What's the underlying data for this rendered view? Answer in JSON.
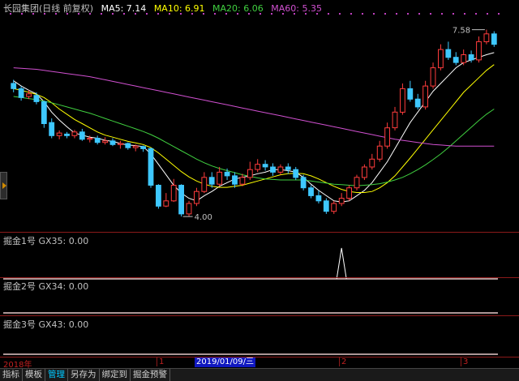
{
  "header": {
    "title": "长园集团(日线 前复权)",
    "ma5": "MA5: 7.14",
    "ma10": "MA10: 6.91",
    "ma20": "MA20: 6.06",
    "ma60": "MA60: 5.35"
  },
  "colors": {
    "up": "#ff3c3c",
    "down": "#3ec8ff",
    "ma5": "#ffffff",
    "ma10": "#ffff00",
    "ma20": "#40d040",
    "ma60": "#d050d0",
    "frame": "#8b1a1a"
  },
  "price_annotations": {
    "high": "7.58",
    "low": "4.00"
  },
  "panels": [
    {
      "label": "掘金1号  GX35: 0.00"
    },
    {
      "label": "掘金2号  GX34: 0.00"
    },
    {
      "label": "掘金3号  GX43: 0.00"
    }
  ],
  "time_axis": {
    "labels": [
      "2018年",
      "1",
      "2",
      "3"
    ],
    "cursor_date": "2019/01/09/三"
  },
  "tabs": [
    "指标",
    "模板",
    "管理",
    "另存为",
    "绑定到",
    "掘金预警"
  ],
  "active_tab": "管理",
  "chart_data": {
    "type": "candlestick",
    "series": [
      {
        "o": 6.55,
        "c": 6.45,
        "h": 6.62,
        "l": 6.38
      },
      {
        "o": 6.45,
        "c": 6.28,
        "h": 6.5,
        "l": 6.22
      },
      {
        "o": 6.3,
        "c": 6.35,
        "h": 6.42,
        "l": 6.25
      },
      {
        "o": 6.32,
        "c": 6.2,
        "h": 6.38,
        "l": 6.15
      },
      {
        "o": 6.2,
        "c": 5.78,
        "h": 6.22,
        "l": 5.7
      },
      {
        "o": 5.8,
        "c": 5.55,
        "h": 5.88,
        "l": 5.5
      },
      {
        "o": 5.55,
        "c": 5.6,
        "h": 5.65,
        "l": 5.48
      },
      {
        "o": 5.58,
        "c": 5.55,
        "h": 5.62,
        "l": 5.5
      },
      {
        "o": 5.55,
        "c": 5.62,
        "h": 5.66,
        "l": 5.5
      },
      {
        "o": 5.62,
        "c": 5.48,
        "h": 5.68,
        "l": 5.45
      },
      {
        "o": 5.48,
        "c": 5.5,
        "h": 5.55,
        "l": 5.42
      },
      {
        "o": 5.5,
        "c": 5.42,
        "h": 5.55,
        "l": 5.38
      },
      {
        "o": 5.42,
        "c": 5.45,
        "h": 5.52,
        "l": 5.38
      },
      {
        "o": 5.45,
        "c": 5.38,
        "h": 5.5,
        "l": 5.35
      },
      {
        "o": 5.38,
        "c": 5.4,
        "h": 5.45,
        "l": 5.3
      },
      {
        "o": 5.4,
        "c": 5.32,
        "h": 5.42,
        "l": 5.28
      },
      {
        "o": 5.32,
        "c": 5.35,
        "h": 5.38,
        "l": 5.25
      },
      {
        "o": 5.34,
        "c": 5.3,
        "h": 5.36,
        "l": 5.24
      },
      {
        "o": 5.3,
        "c": 4.6,
        "h": 5.32,
        "l": 4.55
      },
      {
        "o": 4.6,
        "c": 4.2,
        "h": 4.62,
        "l": 4.15
      },
      {
        "o": 4.2,
        "c": 4.3,
        "h": 4.45,
        "l": 4.18
      },
      {
        "o": 4.3,
        "c": 4.6,
        "h": 4.72,
        "l": 4.28
      },
      {
        "o": 4.6,
        "c": 4.05,
        "h": 4.62,
        "l": 4.0
      },
      {
        "o": 4.05,
        "c": 4.25,
        "h": 4.3,
        "l": 4.0
      },
      {
        "o": 4.25,
        "c": 4.48,
        "h": 4.55,
        "l": 4.2
      },
      {
        "o": 4.48,
        "c": 4.75,
        "h": 4.85,
        "l": 4.45
      },
      {
        "o": 4.75,
        "c": 4.62,
        "h": 4.85,
        "l": 4.55
      },
      {
        "o": 4.62,
        "c": 4.85,
        "h": 4.95,
        "l": 4.58
      },
      {
        "o": 4.85,
        "c": 4.78,
        "h": 4.92,
        "l": 4.7
      },
      {
        "o": 4.78,
        "c": 4.62,
        "h": 4.85,
        "l": 4.55
      },
      {
        "o": 4.62,
        "c": 4.75,
        "h": 4.82,
        "l": 4.58
      },
      {
        "o": 4.75,
        "c": 4.9,
        "h": 5.05,
        "l": 4.7
      },
      {
        "o": 4.9,
        "c": 5.0,
        "h": 5.1,
        "l": 4.85
      },
      {
        "o": 5.0,
        "c": 4.95,
        "h": 5.08,
        "l": 4.88
      },
      {
        "o": 4.95,
        "c": 4.85,
        "h": 5.02,
        "l": 4.78
      },
      {
        "o": 4.85,
        "c": 4.95,
        "h": 5.0,
        "l": 4.8
      },
      {
        "o": 4.95,
        "c": 4.9,
        "h": 5.02,
        "l": 4.82
      },
      {
        "o": 4.9,
        "c": 4.75,
        "h": 4.95,
        "l": 4.7
      },
      {
        "o": 4.75,
        "c": 4.55,
        "h": 4.8,
        "l": 4.5
      },
      {
        "o": 4.55,
        "c": 4.4,
        "h": 4.6,
        "l": 4.35
      },
      {
        "o": 4.4,
        "c": 4.3,
        "h": 4.5,
        "l": 4.25
      },
      {
        "o": 4.3,
        "c": 4.1,
        "h": 4.35,
        "l": 4.05
      },
      {
        "o": 4.1,
        "c": 4.25,
        "h": 4.3,
        "l": 4.05
      },
      {
        "o": 4.25,
        "c": 4.35,
        "h": 4.45,
        "l": 4.2
      },
      {
        "o": 4.35,
        "c": 4.55,
        "h": 4.6,
        "l": 4.3
      },
      {
        "o": 4.55,
        "c": 4.75,
        "h": 4.8,
        "l": 4.5
      },
      {
        "o": 4.75,
        "c": 4.95,
        "h": 5.0,
        "l": 4.7
      },
      {
        "o": 4.95,
        "c": 5.1,
        "h": 5.2,
        "l": 4.9
      },
      {
        "o": 5.1,
        "c": 5.35,
        "h": 5.45,
        "l": 5.05
      },
      {
        "o": 5.35,
        "c": 5.7,
        "h": 5.8,
        "l": 5.3
      },
      {
        "o": 5.7,
        "c": 6.0,
        "h": 6.1,
        "l": 5.65
      },
      {
        "o": 6.0,
        "c": 6.45,
        "h": 6.55,
        "l": 5.95
      },
      {
        "o": 6.45,
        "c": 6.25,
        "h": 6.6,
        "l": 6.2
      },
      {
        "o": 6.25,
        "c": 6.1,
        "h": 6.35,
        "l": 6.05
      },
      {
        "o": 6.1,
        "c": 6.5,
        "h": 6.6,
        "l": 6.05
      },
      {
        "o": 6.5,
        "c": 6.85,
        "h": 6.95,
        "l": 6.45
      },
      {
        "o": 6.85,
        "c": 7.2,
        "h": 7.3,
        "l": 6.8
      },
      {
        "o": 7.2,
        "c": 7.05,
        "h": 7.35,
        "l": 7.0
      },
      {
        "o": 7.05,
        "c": 6.95,
        "h": 7.15,
        "l": 6.9
      },
      {
        "o": 6.95,
        "c": 7.1,
        "h": 7.2,
        "l": 6.9
      },
      {
        "o": 7.1,
        "c": 7.0,
        "h": 7.18,
        "l": 6.95
      },
      {
        "o": 7.0,
        "c": 7.35,
        "h": 7.45,
        "l": 6.95
      },
      {
        "o": 7.35,
        "c": 7.5,
        "h": 7.58,
        "l": 7.3
      },
      {
        "o": 7.5,
        "c": 7.3,
        "h": 7.55,
        "l": 7.25
      }
    ],
    "ma": [
      {
        "name": "MA5",
        "values": [
          6.6,
          6.5,
          6.42,
          6.35,
          6.2,
          6.0,
          5.85,
          5.72,
          5.6,
          5.56,
          5.52,
          5.5,
          5.46,
          5.44,
          5.4,
          5.37,
          5.36,
          5.34,
          5.2,
          5.0,
          4.8,
          4.6,
          4.45,
          4.35,
          4.3,
          4.4,
          4.48,
          4.58,
          4.65,
          4.72,
          4.75,
          4.78,
          4.82,
          4.85,
          4.9,
          4.9,
          4.88,
          4.85,
          4.75,
          4.62,
          4.5,
          4.4,
          4.3,
          4.28,
          4.3,
          4.4,
          4.5,
          4.65,
          4.85,
          5.05,
          5.3,
          5.55,
          5.8,
          6.0,
          6.2,
          6.4,
          6.55,
          6.7,
          6.85,
          6.95,
          7.0,
          7.05,
          7.1,
          7.14
        ]
      },
      {
        "name": "MA10",
        "values": [
          6.45,
          6.42,
          6.38,
          6.34,
          6.28,
          6.18,
          6.06,
          5.96,
          5.86,
          5.78,
          5.7,
          5.62,
          5.56,
          5.52,
          5.48,
          5.44,
          5.41,
          5.38,
          5.32,
          5.22,
          5.1,
          4.98,
          4.86,
          4.76,
          4.68,
          4.62,
          4.58,
          4.56,
          4.56,
          4.58,
          4.6,
          4.64,
          4.68,
          4.72,
          4.76,
          4.8,
          4.82,
          4.83,
          4.82,
          4.78,
          4.72,
          4.65,
          4.58,
          4.52,
          4.48,
          4.46,
          4.46,
          4.48,
          4.55,
          4.65,
          4.78,
          4.95,
          5.12,
          5.3,
          5.48,
          5.66,
          5.84,
          6.02,
          6.2,
          6.38,
          6.52,
          6.66,
          6.8,
          6.91
        ]
      },
      {
        "name": "MA20",
        "values": [
          6.3,
          6.28,
          6.26,
          6.24,
          6.21,
          6.18,
          6.14,
          6.1,
          6.06,
          6.02,
          5.98,
          5.93,
          5.88,
          5.83,
          5.78,
          5.73,
          5.68,
          5.63,
          5.57,
          5.5,
          5.42,
          5.34,
          5.26,
          5.18,
          5.1,
          5.03,
          4.97,
          4.92,
          4.88,
          4.84,
          4.8,
          4.77,
          4.74,
          4.72,
          4.71,
          4.7,
          4.7,
          4.7,
          4.7,
          4.68,
          4.66,
          4.64,
          4.62,
          4.61,
          4.6,
          4.59,
          4.6,
          4.61,
          4.63,
          4.66,
          4.7,
          4.75,
          4.82,
          4.9,
          4.99,
          5.09,
          5.2,
          5.32,
          5.45,
          5.58,
          5.71,
          5.84,
          5.96,
          6.06
        ]
      },
      {
        "name": "MA60",
        "values": [
          6.85,
          6.84,
          6.83,
          6.82,
          6.8,
          6.78,
          6.76,
          6.74,
          6.72,
          6.7,
          6.68,
          6.65,
          6.62,
          6.59,
          6.56,
          6.53,
          6.5,
          6.47,
          6.44,
          6.41,
          6.38,
          6.35,
          6.32,
          6.29,
          6.26,
          6.23,
          6.2,
          6.17,
          6.14,
          6.11,
          6.08,
          6.05,
          6.02,
          5.99,
          5.96,
          5.93,
          5.9,
          5.87,
          5.84,
          5.81,
          5.78,
          5.75,
          5.72,
          5.69,
          5.66,
          5.63,
          5.6,
          5.57,
          5.54,
          5.51,
          5.48,
          5.46,
          5.44,
          5.42,
          5.4,
          5.38,
          5.37,
          5.36,
          5.35,
          5.35,
          5.35,
          5.35,
          5.35,
          5.35
        ]
      }
    ],
    "signal_panel": {
      "peak_index": 43,
      "value": 0.0
    },
    "ylim": [
      3.8,
      7.9
    ]
  }
}
